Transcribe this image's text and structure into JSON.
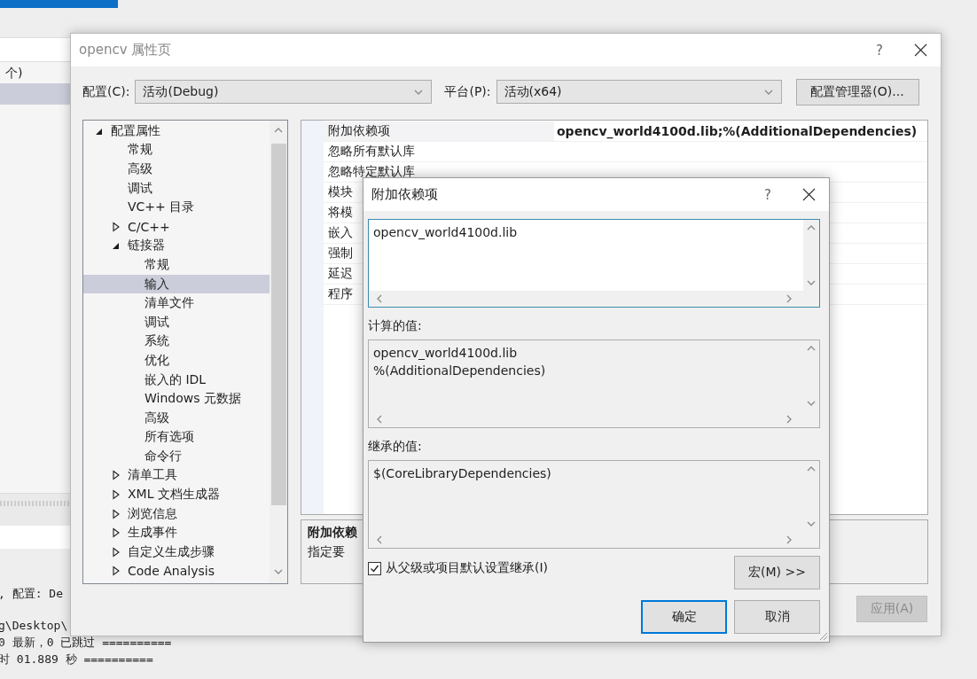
{
  "background_window": {
    "panel_text": "个)",
    "output_lines": [
      ", 配置: De",
      "g\\Desktop\\",
      "0 最新，0 已跳过 ==========",
      "时 01.889 秒 =========="
    ]
  },
  "property_dialog": {
    "title": "opencv 属性页",
    "help": "?",
    "config": {
      "label": "配置(C):",
      "value": "活动(Debug)"
    },
    "platform": {
      "label": "平台(P):",
      "value": "活动(x64)"
    },
    "manager_button": "配置管理器(O)...",
    "tree": [
      {
        "label": "配置属性",
        "expanded": true,
        "selected": false,
        "children": [
          {
            "label": "常规",
            "selected": false
          },
          {
            "label": "高级",
            "selected": false
          },
          {
            "label": "调试",
            "selected": false
          },
          {
            "label": "VC++ 目录",
            "selected": false
          },
          {
            "label": "C/C++",
            "expanded": false,
            "selected": false
          },
          {
            "label": "链接器",
            "expanded": true,
            "selected": false,
            "children": [
              {
                "label": "常规",
                "selected": false
              },
              {
                "label": "输入",
                "selected": true
              },
              {
                "label": "清单文件",
                "selected": false
              },
              {
                "label": "调试",
                "selected": false
              },
              {
                "label": "系统",
                "selected": false
              },
              {
                "label": "优化",
                "selected": false
              },
              {
                "label": "嵌入的 IDL",
                "selected": false
              },
              {
                "label": "Windows 元数据",
                "selected": false
              },
              {
                "label": "高级",
                "selected": false
              },
              {
                "label": "所有选项",
                "selected": false
              },
              {
                "label": "命令行",
                "selected": false
              }
            ]
          },
          {
            "label": "清单工具",
            "expanded": false,
            "selected": false
          },
          {
            "label": "XML 文档生成器",
            "expanded": false,
            "selected": false
          },
          {
            "label": "浏览信息",
            "expanded": false,
            "selected": false
          },
          {
            "label": "生成事件",
            "expanded": false,
            "selected": false
          },
          {
            "label": "自定义生成步骤",
            "expanded": false,
            "selected": false
          },
          {
            "label": "Code Analysis",
            "expanded": false,
            "selected": false
          }
        ]
      }
    ],
    "grid_rows": [
      {
        "name": "附加依赖项",
        "value": "opencv_world4100d.lib;%(AdditionalDependencies)",
        "selected": true
      },
      {
        "name": "忽略所有默认库",
        "selected": false
      },
      {
        "name": "忽略特定默认库",
        "selected": false
      },
      {
        "name": "模块",
        "selected": false
      },
      {
        "name": "将模",
        "selected": false
      },
      {
        "name": "嵌入",
        "selected": false
      },
      {
        "name": "强制",
        "selected": false
      },
      {
        "name": "延迟",
        "selected": false
      },
      {
        "name": "程序",
        "selected": false
      }
    ],
    "description": {
      "title": "附加依赖",
      "text": "指定要"
    },
    "footer_buttons": [
      {
        "label": "应用(A)",
        "disabled": true
      }
    ]
  },
  "dependencies_dialog": {
    "title": "附加依赖项",
    "help": "?",
    "edit_value": "opencv_world4100d.lib",
    "computed_label": "计算的值:",
    "computed_lines": [
      "opencv_world4100d.lib",
      "%(AdditionalDependencies)"
    ],
    "inherited_label": "继承的值:",
    "inherited_lines": [
      "$(CoreLibraryDependencies)"
    ],
    "inherit_checkbox": {
      "label": "从父级或项目默认设置继承(I)",
      "checked": true
    },
    "macro_button": "宏(M) >>",
    "buttons": [
      {
        "label": "确定",
        "default": true
      },
      {
        "label": "取消",
        "default": false
      }
    ]
  }
}
